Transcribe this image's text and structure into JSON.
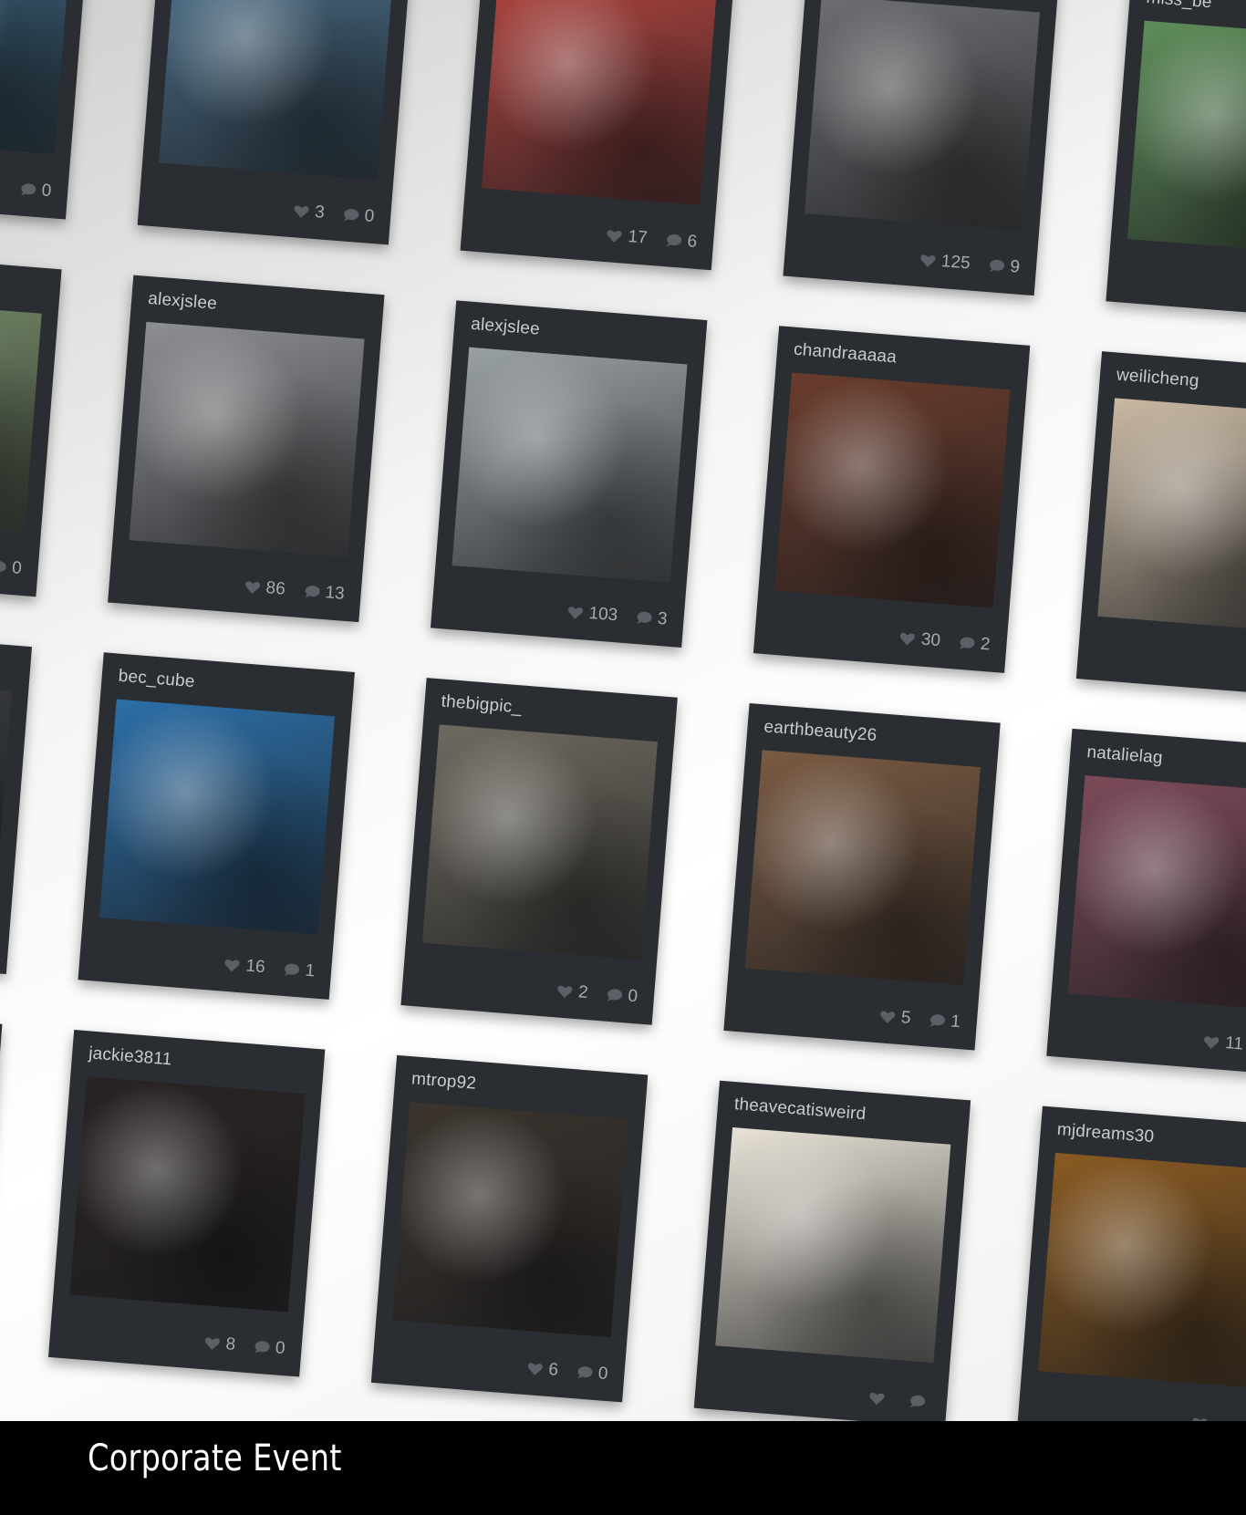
{
  "posts": [
    {
      "user": "",
      "likes": "",
      "comments": "0"
    },
    {
      "user": "",
      "likes": "3",
      "comments": "0"
    },
    {
      "user": "",
      "likes": "17",
      "comments": "6"
    },
    {
      "user": "",
      "likes": "125",
      "comments": "9"
    },
    {
      "user": "miss_be",
      "likes": "",
      "comments": ""
    },
    {
      "user": "",
      "likes": "",
      "comments": "0"
    },
    {
      "user": "alexjslee",
      "likes": "86",
      "comments": "13"
    },
    {
      "user": "alexjslee",
      "likes": "103",
      "comments": "3"
    },
    {
      "user": "chandraaaaa",
      "likes": "30",
      "comments": "2"
    },
    {
      "user": "weilicheng",
      "likes": "",
      "comments": ""
    },
    {
      "user": "",
      "likes": "",
      "comments": ""
    },
    {
      "user": "bec_cube",
      "likes": "16",
      "comments": "1"
    },
    {
      "user": "thebigpic_",
      "likes": "2",
      "comments": "0"
    },
    {
      "user": "earthbeauty26",
      "likes": "5",
      "comments": "1"
    },
    {
      "user": "natalielag",
      "likes": "11",
      "comments": ""
    },
    {
      "user": "",
      "likes": "",
      "comments": ""
    },
    {
      "user": "jackie3811",
      "likes": "8",
      "comments": "0"
    },
    {
      "user": "mtrop92",
      "likes": "6",
      "comments": "0"
    },
    {
      "user": "theavecatisweird",
      "likes": "",
      "comments": ""
    },
    {
      "user": "mjdreams30",
      "likes": "",
      "comments": ""
    }
  ],
  "photo_themes": [
    "#3e6a86",
    "#4a6f8a",
    "#b2443f",
    "#6d6e71",
    "#5f8d5a",
    "#7a8f6c",
    "#8d8f92",
    "#9aa1a5",
    "#6a3c2c",
    "#c9b9a3",
    "#3a3c3e",
    "#2c6fa8",
    "#6f6a60",
    "#7a5a42",
    "#7c4a58",
    "#2b2b2b",
    "#2a2324",
    "#3b342e",
    "#e8e2d6",
    "#8a5a22"
  ],
  "caption": "Corporate Event"
}
